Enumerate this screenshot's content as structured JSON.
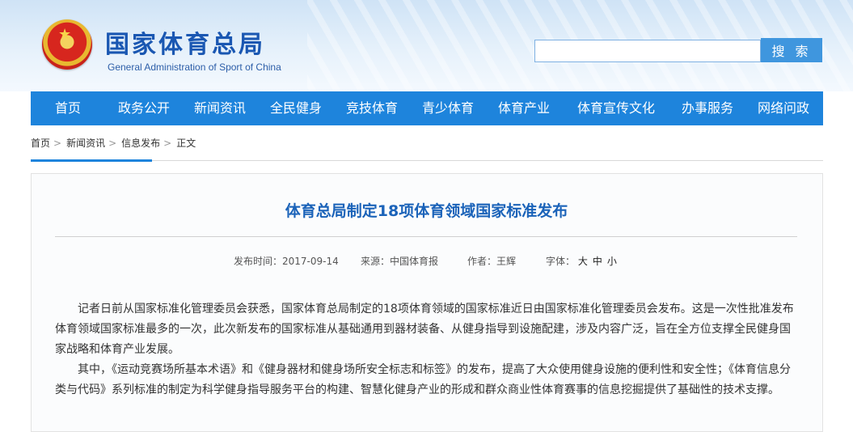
{
  "header": {
    "site_name_cn": "国家体育总局",
    "site_name_en": "General Administration of Sport of China",
    "emblem_icon": "national-emblem-icon",
    "search": {
      "placeholder": "",
      "button_label": "搜 索"
    }
  },
  "nav": {
    "items": [
      "首页",
      "政务公开",
      "新闻资讯",
      "全民健身",
      "竞技体育",
      "青少体育",
      "体育产业",
      "体育宣传文化",
      "办事服务",
      "网络问政"
    ]
  },
  "breadcrumb": {
    "items": [
      "首页",
      "新闻资讯",
      "信息发布",
      "正文"
    ],
    "separator": ">"
  },
  "article": {
    "title": "体育总局制定18项体育领域国家标准发布",
    "meta": {
      "date_label": "发布时间：",
      "date": "2017-09-14",
      "source_label": "来源：",
      "source": "中国体育报",
      "author_label": "作者：",
      "author": "王辉",
      "fontsize_label": "字体：",
      "fontsize_options": [
        "大",
        "中",
        "小"
      ]
    },
    "paragraphs": [
      "记者日前从国家标准化管理委员会获悉，国家体育总局制定的18项体育领域的国家标准近日由国家标准化管理委员会发布。这是一次性批准发布体育领域国家标准最多的一次，此次新发布的国家标准从基础通用到器材装备、从健身指导到设施配建，涉及内容广泛，旨在全方位支撑全民健身国家战略和体育产业发展。",
      "其中，《运动竞赛场所基本术语》和《健身器材和健身场所安全标志和标签》的发布，提高了大众使用健身设施的便利性和安全性；《体育信息分类与代码》系列标准的制定为科学健身指导服务平台的构建、智慧化健身产业的形成和群众商业性体育赛事的信息挖掘提供了基础性的技术支撑。"
    ]
  },
  "colors": {
    "nav_bg": "#1e84dc",
    "title": "#1b63b9",
    "logo": "#1a57b2",
    "search_button": "#3f96de"
  }
}
